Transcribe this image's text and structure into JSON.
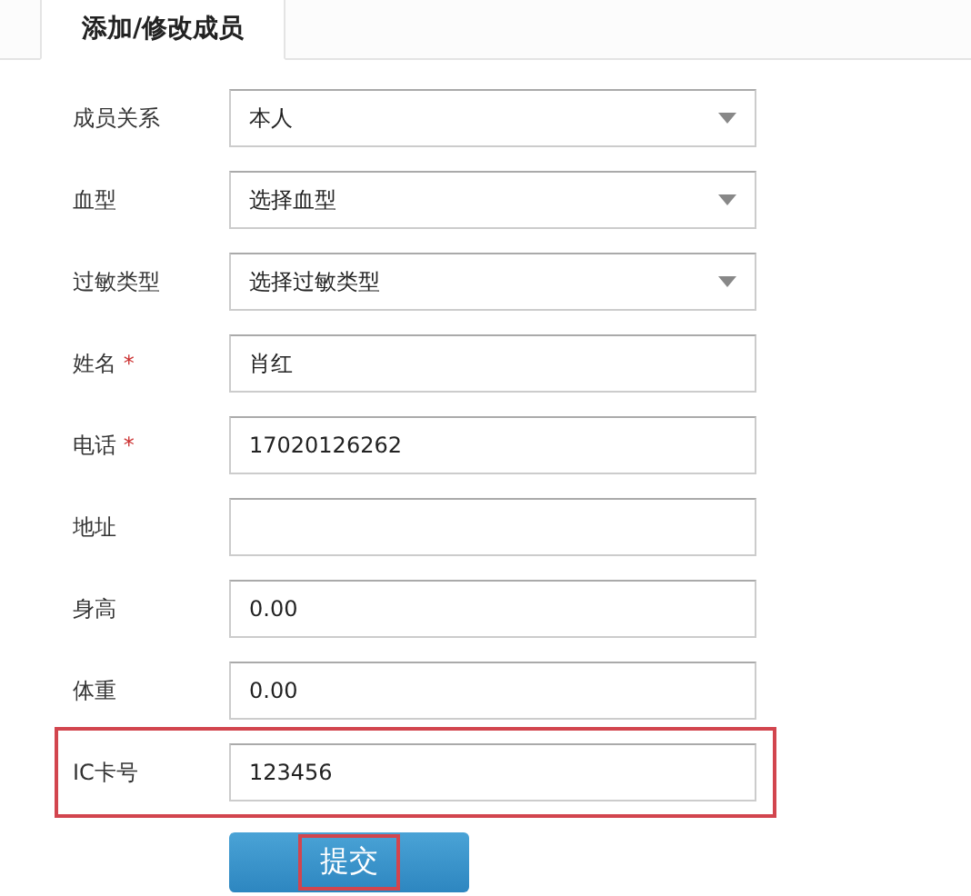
{
  "tabs": [
    {
      "label": "添加/修改成员",
      "selected": true
    }
  ],
  "fields": [
    {
      "label": "成员关系",
      "kind": "select",
      "value": "本人",
      "required": false,
      "highlighted": false
    },
    {
      "label": "血型",
      "kind": "select",
      "value": "选择血型",
      "required": false,
      "highlighted": false
    },
    {
      "label": "过敏类型",
      "kind": "select",
      "value": "选择过敏类型",
      "required": false,
      "highlighted": false
    },
    {
      "label": "姓名",
      "kind": "input",
      "value": "肖红",
      "required": true,
      "highlighted": false
    },
    {
      "label": "电话",
      "kind": "input",
      "value": "17020126262",
      "required": true,
      "highlighted": false
    },
    {
      "label": "地址",
      "kind": "input",
      "required": false,
      "highlighted": false
    },
    {
      "label": "身高",
      "kind": "input",
      "value": "0.00",
      "required": false,
      "highlighted": false
    },
    {
      "label": "体重",
      "kind": "input",
      "value": "0.00",
      "required": false,
      "highlighted": false
    },
    {
      "label": "IC卡号",
      "kind": "input",
      "value": "123456",
      "required": false,
      "highlighted": true
    }
  ],
  "required_mark": "*",
  "submit": {
    "label": "提交",
    "highlighted": true
  }
}
